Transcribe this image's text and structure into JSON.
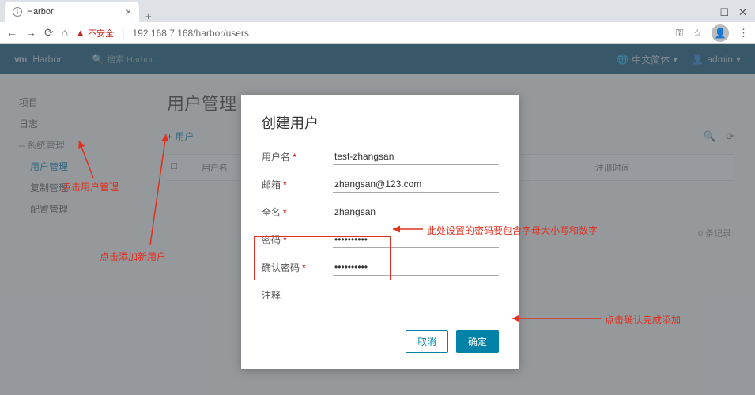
{
  "browser": {
    "tab_title": "Harbor",
    "insecure_label": "不安全",
    "url": "192.168.7.168/harbor/users"
  },
  "window_controls": {
    "min": "—",
    "max": "☐",
    "close": "✕"
  },
  "header": {
    "logo_text": "vm",
    "app_name": "Harbor",
    "search_placeholder": "搜索 Harbor...",
    "lang_label": "中文简体",
    "user_label": "admin"
  },
  "sidebar": {
    "items": [
      {
        "label": "项目"
      },
      {
        "label": "日志"
      },
      {
        "label": "系统管理",
        "expand": "–"
      }
    ],
    "sub": [
      {
        "label": "用户管理",
        "active": true
      },
      {
        "label": "复制管理"
      },
      {
        "label": "配置管理"
      }
    ]
  },
  "page": {
    "title": "用户管理",
    "add_user": "+ 用户",
    "columns": {
      "checkbox": "",
      "username": "用户名",
      "reg_time": "注册时间"
    },
    "records": "0 条记录"
  },
  "modal": {
    "title": "创建用户",
    "fields": {
      "username_label": "用户名",
      "username_value": "test-zhangsan",
      "email_label": "邮箱",
      "email_value": "zhangsan@123.com",
      "fullname_label": "全名",
      "fullname_value": "zhangsan",
      "password_label": "密码",
      "password_value": "••••••••••",
      "confirm_label": "确认密码",
      "confirm_value": "••••••••••",
      "comment_label": "注释",
      "comment_value": ""
    },
    "cancel": "取消",
    "ok": "确定"
  },
  "annotations": {
    "a1": "点击用户管理",
    "a2": "点击添加新用户",
    "a3": "此处设置的密码要包含字母大小写和数字",
    "a4": "点击确认完成添加"
  }
}
